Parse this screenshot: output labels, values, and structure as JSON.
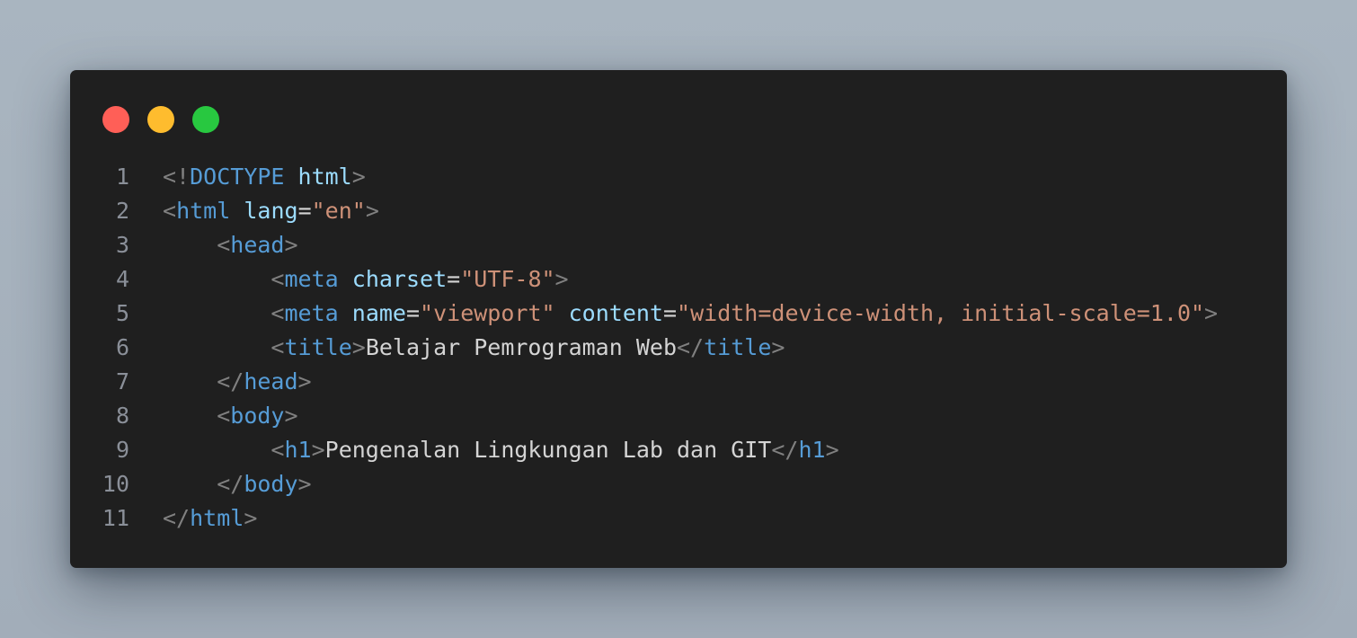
{
  "window": {
    "traffic_lights": [
      {
        "name": "close",
        "color": "#ff5f57"
      },
      {
        "name": "minimize",
        "color": "#febc2e"
      },
      {
        "name": "maximize",
        "color": "#28c840"
      }
    ]
  },
  "theme": {
    "background": "#1f1f1f",
    "tag": "#569cd6",
    "attribute": "#9cdcfe",
    "string": "#ce9178",
    "punctuation": "#808080",
    "text": "#d4d4d4",
    "line_number": "#8a8f98"
  },
  "code": {
    "lines": [
      {
        "number": "1",
        "tokens": [
          {
            "type": "punc",
            "text": "<!"
          },
          {
            "type": "tag",
            "text": "DOCTYPE"
          },
          {
            "type": "txt",
            "text": " "
          },
          {
            "type": "attr",
            "text": "html"
          },
          {
            "type": "punc",
            "text": ">"
          }
        ]
      },
      {
        "number": "2",
        "tokens": [
          {
            "type": "punc",
            "text": "<"
          },
          {
            "type": "tag",
            "text": "html"
          },
          {
            "type": "txt",
            "text": " "
          },
          {
            "type": "attr",
            "text": "lang"
          },
          {
            "type": "txt",
            "text": "="
          },
          {
            "type": "str",
            "text": "\"en\""
          },
          {
            "type": "punc",
            "text": ">"
          }
        ]
      },
      {
        "number": "3",
        "tokens": [
          {
            "type": "txt",
            "text": "    "
          },
          {
            "type": "punc",
            "text": "<"
          },
          {
            "type": "tag",
            "text": "head"
          },
          {
            "type": "punc",
            "text": ">"
          }
        ]
      },
      {
        "number": "4",
        "tokens": [
          {
            "type": "txt",
            "text": "        "
          },
          {
            "type": "punc",
            "text": "<"
          },
          {
            "type": "tag",
            "text": "meta"
          },
          {
            "type": "txt",
            "text": " "
          },
          {
            "type": "attr",
            "text": "charset"
          },
          {
            "type": "txt",
            "text": "="
          },
          {
            "type": "str",
            "text": "\"UTF-8\""
          },
          {
            "type": "punc",
            "text": ">"
          }
        ]
      },
      {
        "number": "5",
        "tokens": [
          {
            "type": "txt",
            "text": "        "
          },
          {
            "type": "punc",
            "text": "<"
          },
          {
            "type": "tag",
            "text": "meta"
          },
          {
            "type": "txt",
            "text": " "
          },
          {
            "type": "attr",
            "text": "name"
          },
          {
            "type": "txt",
            "text": "="
          },
          {
            "type": "str",
            "text": "\"viewport\""
          },
          {
            "type": "txt",
            "text": " "
          },
          {
            "type": "attr",
            "text": "content"
          },
          {
            "type": "txt",
            "text": "="
          },
          {
            "type": "str",
            "text": "\"width=device-width, initial-scale=1.0\""
          },
          {
            "type": "punc",
            "text": ">"
          }
        ]
      },
      {
        "number": "6",
        "tokens": [
          {
            "type": "txt",
            "text": "        "
          },
          {
            "type": "punc",
            "text": "<"
          },
          {
            "type": "tag",
            "text": "title"
          },
          {
            "type": "punc",
            "text": ">"
          },
          {
            "type": "txt",
            "text": "Belajar Pemrograman Web"
          },
          {
            "type": "punc",
            "text": "</"
          },
          {
            "type": "tag",
            "text": "title"
          },
          {
            "type": "punc",
            "text": ">"
          }
        ]
      },
      {
        "number": "7",
        "tokens": [
          {
            "type": "txt",
            "text": "    "
          },
          {
            "type": "punc",
            "text": "</"
          },
          {
            "type": "tag",
            "text": "head"
          },
          {
            "type": "punc",
            "text": ">"
          }
        ]
      },
      {
        "number": "8",
        "tokens": [
          {
            "type": "txt",
            "text": "    "
          },
          {
            "type": "punc",
            "text": "<"
          },
          {
            "type": "tag",
            "text": "body"
          },
          {
            "type": "punc",
            "text": ">"
          }
        ]
      },
      {
        "number": "9",
        "tokens": [
          {
            "type": "txt",
            "text": "        "
          },
          {
            "type": "punc",
            "text": "<"
          },
          {
            "type": "tag",
            "text": "h1"
          },
          {
            "type": "punc",
            "text": ">"
          },
          {
            "type": "txt",
            "text": "Pengenalan Lingkungan Lab dan GIT"
          },
          {
            "type": "punc",
            "text": "</"
          },
          {
            "type": "tag",
            "text": "h1"
          },
          {
            "type": "punc",
            "text": ">"
          }
        ]
      },
      {
        "number": "10",
        "tokens": [
          {
            "type": "txt",
            "text": "    "
          },
          {
            "type": "punc",
            "text": "</"
          },
          {
            "type": "tag",
            "text": "body"
          },
          {
            "type": "punc",
            "text": ">"
          }
        ]
      },
      {
        "number": "11",
        "tokens": [
          {
            "type": "punc",
            "text": "</"
          },
          {
            "type": "tag",
            "text": "html"
          },
          {
            "type": "punc",
            "text": ">"
          }
        ]
      }
    ]
  }
}
